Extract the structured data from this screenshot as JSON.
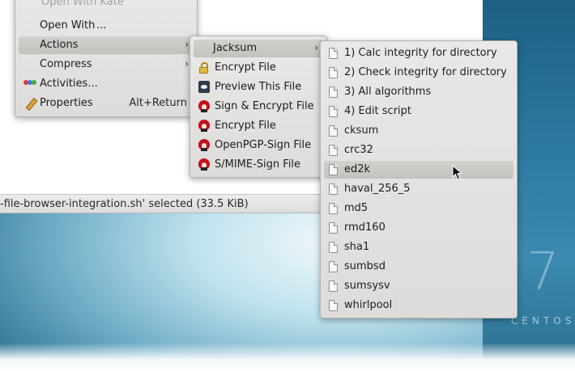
{
  "status_bar": {
    "text": "-file-browser-integration.sh' selected (33.5 KiB)"
  },
  "desktop": {
    "brand_number": "7",
    "brand_name": "CENTOS"
  },
  "context_menu": {
    "items": [
      {
        "label": "Open With",
        "icon": "none"
      },
      {
        "label": "Actions",
        "icon": "none",
        "has_submenu": true,
        "active": true
      },
      {
        "label": "Compress",
        "icon": "none",
        "has_submenu": true
      },
      {
        "label": "Activities...",
        "icon": "activities-icon"
      },
      {
        "label": "Properties",
        "icon": "pencil-icon",
        "shortcut": "Alt+Return"
      }
    ],
    "partial_top_label": "Open With Kate"
  },
  "actions_menu": {
    "items": [
      {
        "label": "Jacksum",
        "has_submenu": true,
        "active": true
      },
      {
        "label": "Encrypt File",
        "icon": "lock-icon"
      },
      {
        "label": "Preview This File",
        "icon": "preview-icon"
      },
      {
        "label": "Sign & Encrypt File",
        "icon": "kgpg-icon"
      },
      {
        "label": "Encrypt File",
        "icon": "kgpg-icon"
      },
      {
        "label": "OpenPGP-Sign File",
        "icon": "kgpg-icon"
      },
      {
        "label": "S/MIME-Sign File",
        "icon": "kgpg-icon"
      }
    ]
  },
  "jacksum_menu": {
    "items": [
      {
        "label": "1) Calc integrity for directory"
      },
      {
        "label": "2) Check integrity for directory"
      },
      {
        "label": "3) All algorithms"
      },
      {
        "label": "4) Edit script"
      },
      {
        "label": "cksum"
      },
      {
        "label": "crc32"
      },
      {
        "label": "ed2k",
        "active": true
      },
      {
        "label": "haval_256_5"
      },
      {
        "label": "md5"
      },
      {
        "label": "rmd160"
      },
      {
        "label": "sha1"
      },
      {
        "label": "sumbsd"
      },
      {
        "label": "sumsysv"
      },
      {
        "label": "whirlpool"
      }
    ]
  },
  "colors": {
    "menu_bg": "#e3e2e0",
    "highlight": "#c8c7c4",
    "desktop_blue": "#2d7aa0"
  }
}
